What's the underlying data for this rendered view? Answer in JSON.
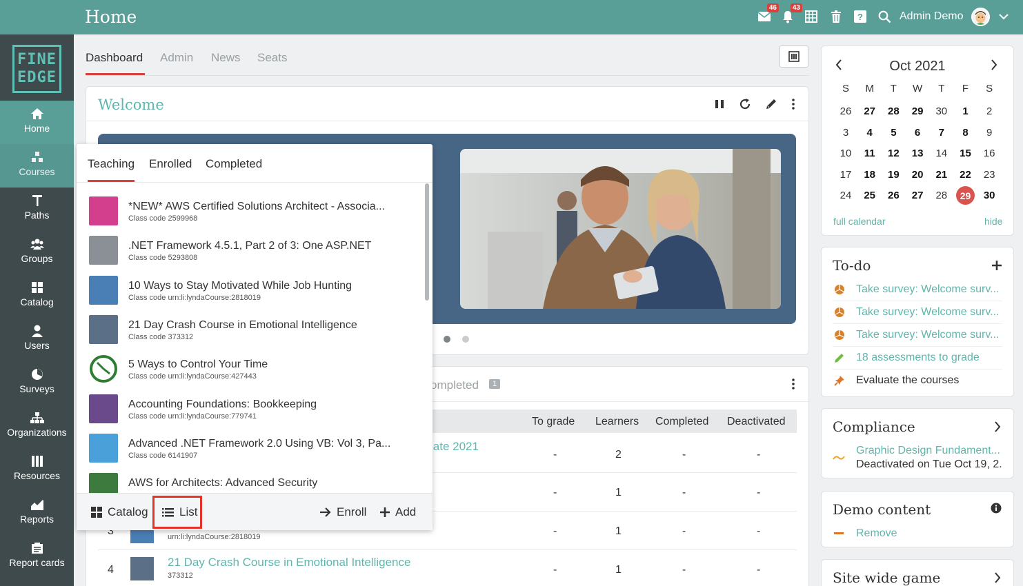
{
  "topbar": {
    "title": "Home",
    "mail_badge": "46",
    "notif_badge": "43",
    "user_name": "Admin Demo"
  },
  "sidebar": {
    "logo_line1": "FINE",
    "logo_line2": "EDGE",
    "items": [
      {
        "label": "Home",
        "icon": "home-icon"
      },
      {
        "label": "Courses",
        "icon": "courses-icon"
      },
      {
        "label": "Paths",
        "icon": "paths-icon"
      },
      {
        "label": "Groups",
        "icon": "groups-icon"
      },
      {
        "label": "Catalog",
        "icon": "catalog-icon"
      },
      {
        "label": "Users",
        "icon": "users-icon"
      },
      {
        "label": "Surveys",
        "icon": "surveys-icon"
      },
      {
        "label": "Organizations",
        "icon": "organizations-icon"
      },
      {
        "label": "Resources",
        "icon": "resources-icon"
      },
      {
        "label": "Reports",
        "icon": "reports-icon"
      },
      {
        "label": "Report cards",
        "icon": "report-cards-icon"
      }
    ]
  },
  "tabs": [
    "Dashboard",
    "Admin",
    "News",
    "Seats"
  ],
  "welcome": {
    "title": "Welcome"
  },
  "courses_table": {
    "partial_tab": "ompleted",
    "partial_tab_count": "1",
    "columns": [
      "To grade",
      "Learners",
      "Completed",
      "Deactivated"
    ],
    "rows": [
      {
        "num": "",
        "title": "iate 2021",
        "code": "",
        "to_grade": "-",
        "learners": "2",
        "completed": "-",
        "deactivated": "-"
      },
      {
        "num": "",
        "title": "",
        "code": "",
        "to_grade": "-",
        "learners": "1",
        "completed": "-",
        "deactivated": "-"
      },
      {
        "num": "3",
        "title": "",
        "code": "urn:li:lyndaCourse:2818019",
        "to_grade": "-",
        "learners": "1",
        "completed": "-",
        "deactivated": "-"
      },
      {
        "num": "4",
        "title": "21 Day Crash Course in Emotional Intelligence",
        "code": "373312",
        "to_grade": "-",
        "learners": "1",
        "completed": "-",
        "deactivated": "-"
      }
    ]
  },
  "dropdown": {
    "tabs": [
      "Teaching",
      "Enrolled",
      "Completed"
    ],
    "items": [
      {
        "title": "*NEW* AWS Certified Solutions Architect - Associa...",
        "code": "Class code 2599968",
        "color": "#d43f8d"
      },
      {
        "title": ".NET Framework 4.5.1, Part 2 of 3: One ASP.NET",
        "code": "Class code 5293808",
        "color": "#8a9096"
      },
      {
        "title": "10 Ways to Stay Motivated While Job Hunting",
        "code": "Class code urn:li:lyndaCourse:2818019",
        "color": "#4a7fb5"
      },
      {
        "title": "21 Day Crash Course in Emotional Intelligence",
        "code": "Class code 373312",
        "color": "#5b6f86"
      },
      {
        "title": "5 Ways to Control Your Time",
        "code": "Class code urn:li:lyndaCourse:427443",
        "color": "#3a8a4a"
      },
      {
        "title": "Accounting Foundations: Bookkeeping",
        "code": "Class code urn:li:lyndaCourse:779741",
        "color": "#6a4a8a"
      },
      {
        "title": "Advanced .NET Framework 2.0 Using VB: Vol 3, Pa...",
        "code": "Class code 6141907",
        "color": "#4aa0d8"
      },
      {
        "title": "AWS for Architects: Advanced Security",
        "code": "",
        "color": "#3d7a3d"
      }
    ],
    "footer": {
      "catalog": "Catalog",
      "list": "List",
      "enroll": "Enroll",
      "add": "Add"
    }
  },
  "calendar": {
    "month": "Oct 2021",
    "weekdays": [
      "S",
      "M",
      "T",
      "W",
      "T",
      "F",
      "S"
    ],
    "weeks": [
      [
        "26",
        "27",
        "28",
        "29",
        "30",
        "1",
        "2"
      ],
      [
        "3",
        "4",
        "5",
        "6",
        "7",
        "8",
        "9"
      ],
      [
        "10",
        "11",
        "12",
        "13",
        "14",
        "15",
        "16"
      ],
      [
        "17",
        "18",
        "19",
        "20",
        "21",
        "22",
        "23"
      ],
      [
        "24",
        "25",
        "26",
        "27",
        "28",
        "29",
        "30"
      ]
    ],
    "full_calendar": "full calendar",
    "hide": "hide"
  },
  "todo": {
    "title": "To-do",
    "items": [
      {
        "text": "Take survey: Welcome surv...",
        "type": "survey"
      },
      {
        "text": "Take survey: Welcome surv...",
        "type": "survey"
      },
      {
        "text": "Take survey: Welcome surv...",
        "type": "survey"
      },
      {
        "text": "18 assessments to grade",
        "type": "grade"
      },
      {
        "text": "Evaluate the courses",
        "type": "evaluate"
      }
    ]
  },
  "compliance": {
    "title": "Compliance",
    "course": "Graphic Design Fundament...",
    "status": "Deactivated on Tue Oct 19, 2..."
  },
  "demo_content": {
    "title": "Demo content",
    "remove": "Remove"
  },
  "site_game": {
    "title": "Site wide game"
  },
  "colors": {
    "topbar": "#5a9e98",
    "sidebar": "#3f4a4c",
    "accent": "#5fb6ad",
    "red": "#d9413c"
  }
}
